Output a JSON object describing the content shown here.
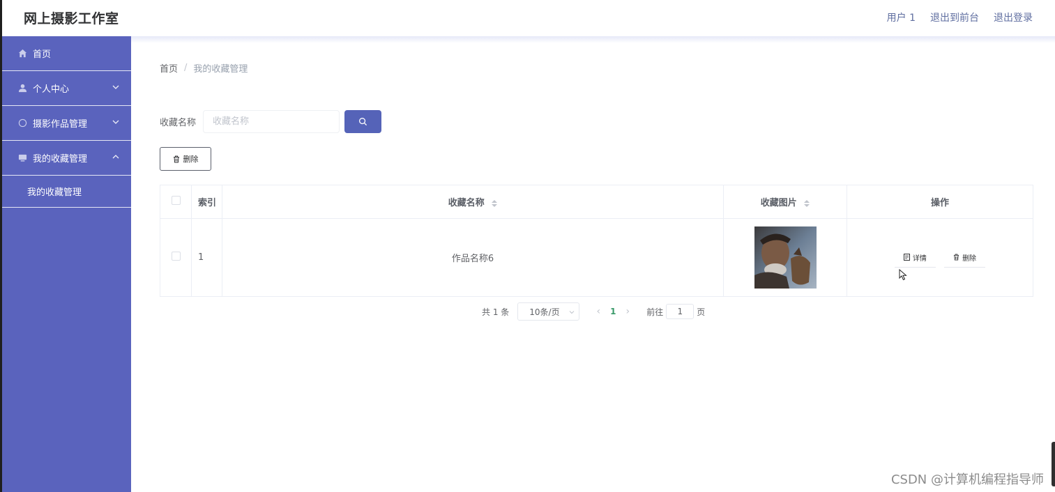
{
  "header": {
    "title": "网上摄影工作室",
    "links": [
      "用户 1",
      "退出到前台",
      "退出登录"
    ]
  },
  "sidebar": {
    "items": [
      {
        "label": "首页",
        "icon": "home-icon"
      },
      {
        "label": "个人中心",
        "icon": "user-icon"
      },
      {
        "label": "摄影作品管理",
        "icon": "compass-icon"
      },
      {
        "label": "我的收藏管理",
        "icon": "folder-icon"
      }
    ],
    "subitems": [
      {
        "label": "我的收藏管理"
      }
    ]
  },
  "breadcrumb": {
    "home": "首页",
    "separator": "/",
    "current": "我的收藏管理"
  },
  "search": {
    "label": "收藏名称",
    "placeholder": "收藏名称",
    "value": ""
  },
  "toolbar": {
    "delete_label": "删除"
  },
  "table": {
    "headers": {
      "index": "索引",
      "name": "收藏名称",
      "image": "收藏图片",
      "actions": "操作"
    },
    "rows": [
      {
        "index": "1",
        "name": "作品名称6",
        "image": "portrait-photo"
      }
    ],
    "row_actions": {
      "detail": "详情",
      "delete": "删除"
    }
  },
  "pagination": {
    "total": "共 1 条",
    "page_size": "10条/页",
    "prev": "‹",
    "next": "›",
    "current_page": "1",
    "goto_label": "前往",
    "goto_value": "1",
    "page_unit": "页"
  },
  "watermark": "CSDN @计算机编程指导师",
  "colors": {
    "sidebar_bg": "#5a63bd",
    "primary_btn": "#5563b8",
    "active_page": "#3a9a6a"
  }
}
